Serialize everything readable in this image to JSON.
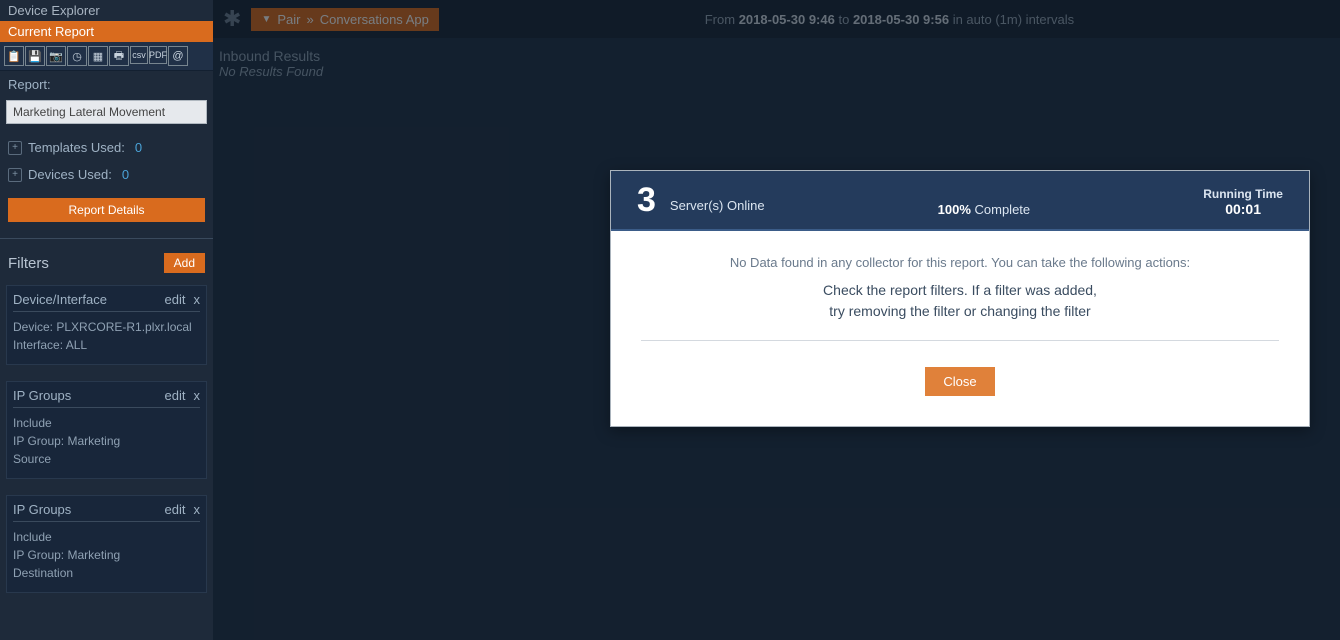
{
  "sidebar": {
    "tabs": {
      "explorer": "Device Explorer",
      "current": "Current Report"
    },
    "report_label": "Report:",
    "report_value": "Marketing Lateral Movement",
    "templates_label": "Templates Used:",
    "templates_count": "0",
    "devices_label": "Devices Used:",
    "devices_count": "0",
    "report_details_btn": "Report Details",
    "filters_title": "Filters",
    "add_btn": "Add",
    "filters": [
      {
        "title": "Device/Interface",
        "edit": "edit",
        "close": "x",
        "lines": [
          "Device: PLXRCORE-R1.plxr.local",
          "Interface: ALL"
        ]
      },
      {
        "title": "IP Groups",
        "edit": "edit",
        "close": "x",
        "lines": [
          "Include",
          "IP Group: Marketing",
          "Source"
        ]
      },
      {
        "title": "IP Groups",
        "edit": "edit",
        "close": "x",
        "lines": [
          "Include",
          "IP Group: Marketing",
          "Destination"
        ]
      }
    ]
  },
  "topbar": {
    "breadcrumb_pair": "Pair",
    "breadcrumb_sep": "»",
    "breadcrumb_app": "Conversations App",
    "time_from_lbl": "From",
    "time_from": "2018-05-30 9:46",
    "time_to_lbl": "to",
    "time_to": "2018-05-30 9:56",
    "time_tail": "in auto (1m) intervals"
  },
  "content": {
    "heading": "Inbound Results",
    "noresults": "No Results Found"
  },
  "modal": {
    "servers_count": "3",
    "servers_label": "Server(s) Online",
    "complete_pct": "100%",
    "complete_label": "Complete",
    "running_label": "Running Time",
    "running_value": "00:01",
    "body_line1": "No Data found in any collector for this report. You can take the following actions:",
    "body_line2a": "Check the report filters. If a filter was added,",
    "body_line2b": "try removing the filter or changing the filter",
    "close": "Close"
  }
}
